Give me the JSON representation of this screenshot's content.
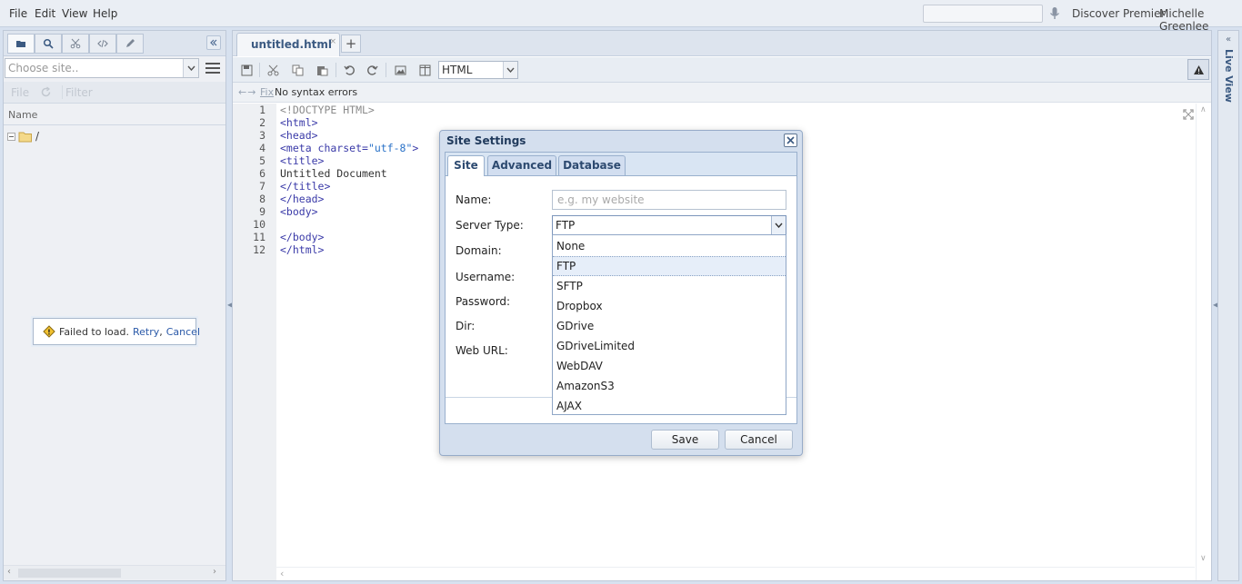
{
  "menu": [
    "File",
    "Edit",
    "View",
    "Help"
  ],
  "header": {
    "discover": "Discover Premier",
    "user": "Michelle Greenlee"
  },
  "left": {
    "site_placeholder": "Choose site..",
    "sub_toolbar": [
      "File",
      "Filter"
    ],
    "name_header": "Name",
    "tree_root": "/",
    "failed": {
      "text": "Failed to load.",
      "retry": "Retry",
      "comma": ",",
      "cancel": "Cancel"
    }
  },
  "editor": {
    "tab_name": "untitled.html",
    "mode": "HTML",
    "status": {
      "fix": "Fix",
      "message": "No syntax errors"
    },
    "lines": [
      "1",
      "2",
      "3",
      "4",
      "5",
      "6",
      "7",
      "8",
      "9",
      "10",
      "11",
      "12"
    ],
    "code": {
      "l1": "<!DOCTYPE HTML>",
      "l2": "<html>",
      "l3": "<head>",
      "l4a": "<meta charset=",
      "l4b": "\"utf-8\"",
      "l4c": ">",
      "l5": "<title>",
      "l6": "Untitled Document",
      "l7": "</title>",
      "l8": "</head>",
      "l9": "<body>",
      "l11": "</body>",
      "l12": "</html>"
    }
  },
  "live_view": "Live View",
  "dialog": {
    "title": "Site Settings",
    "tabs": [
      "Site",
      "Advanced",
      "Database"
    ],
    "labels": {
      "name": "Name:",
      "server_type": "Server Type:",
      "domain": "Domain:",
      "username": "Username:",
      "password": "Password:",
      "dir": "Dir:",
      "web_url": "Web URL:"
    },
    "name_placeholder": "e.g. my website",
    "server_type_value": "FTP",
    "server_options": [
      "None",
      "FTP",
      "SFTP",
      "Dropbox",
      "GDrive",
      "GDriveLimited",
      "WebDAV",
      "AmazonS3",
      "AJAX"
    ],
    "save": "Save",
    "cancel": "Cancel"
  },
  "colors": {
    "accent": "#3b5a82",
    "panel_bg": "#d7e1ef",
    "link": "#2a59a8"
  }
}
